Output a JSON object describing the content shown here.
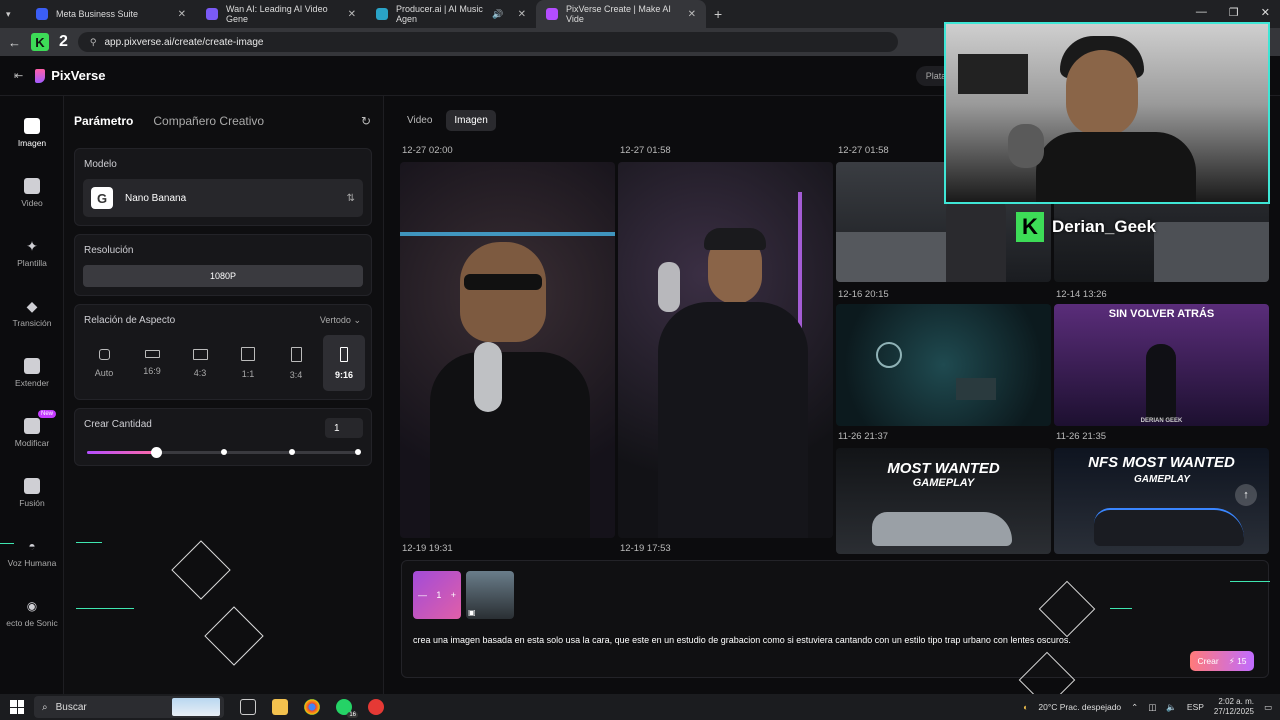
{
  "browser": {
    "tabs": [
      {
        "title": "Meta Business Suite",
        "favicon_color": "#3b5ef5"
      },
      {
        "title": "Wan AI: Leading AI Video Gene",
        "favicon_color": "#7a5af5"
      },
      {
        "title": "Producer.ai | AI Music Agen",
        "favicon_color": "#2aa3c7"
      },
      {
        "title": "PixVerse Create | Make AI Vide",
        "favicon_color": "#b44dff"
      }
    ],
    "url": "app.pixverse.ai/create/create-image"
  },
  "app": {
    "name": "PixVerse",
    "header_button": "Plata"
  },
  "sidebar": {
    "items": [
      {
        "label": "Imagen",
        "active": true
      },
      {
        "label": "Video"
      },
      {
        "label": "Plantilla"
      },
      {
        "label": "Transición"
      },
      {
        "label": "Extender"
      },
      {
        "label": "Modificar",
        "badge": "New"
      },
      {
        "label": "Fusión"
      },
      {
        "label": "Voz Humana"
      },
      {
        "label": "ecto de Sonic"
      }
    ]
  },
  "panel": {
    "tabs": [
      "Parámetro",
      "Compañero Creativo"
    ],
    "model": {
      "title": "Modelo",
      "value": "Nano Banana",
      "icon_letter": "G"
    },
    "resolution": {
      "title": "Resolución",
      "value": "1080P"
    },
    "aspect": {
      "title": "Relación de Aspecto",
      "mode": "Vertodo",
      "options": [
        "Auto",
        "16:9",
        "4:3",
        "1:1",
        "3:4",
        "9:16"
      ],
      "selected": "9:16"
    },
    "quantity": {
      "title": "Crear Cantidad",
      "value": "1",
      "slider_fraction": 0.25
    }
  },
  "main": {
    "tabs": [
      "Video",
      "Imagen"
    ],
    "active_tab": "Imagen",
    "timestamps": {
      "a": "12-27 02:00",
      "b": "12-27 01:58",
      "c": "12-27 01:58",
      "d": "12-16 20:15",
      "e": "12-14 13:26",
      "f": "11-26 21:37",
      "g": "11-26 21:35",
      "h": "12-19 19:31",
      "i": "12-19 17:53"
    },
    "captions": {
      "sin_volver": "SIN VOLVER ATRÁS",
      "most_wanted": "MOST WANTED",
      "gameplay": "GAMEPLAY",
      "nfs_most_wanted": "NFS MOST WANTED",
      "derian_geek": "DERIAN GEEK"
    }
  },
  "prompt": {
    "count": "1",
    "text": "crea una imagen basada en esta solo usa la cara, que este en un estudio de grabacion como si estuviera cantando con un estilo tipo trap urbano con lentes oscuros.",
    "create_label": "Crear",
    "credits": "15"
  },
  "overlay": {
    "streamer": "Derian_Geek"
  },
  "taskbar": {
    "search": "Buscar",
    "weather": "20°C  Prac. despejado",
    "lang": "ESP",
    "time": "2:02 a. m.",
    "date": "27/12/2025",
    "whatsapp_badge": "16"
  }
}
